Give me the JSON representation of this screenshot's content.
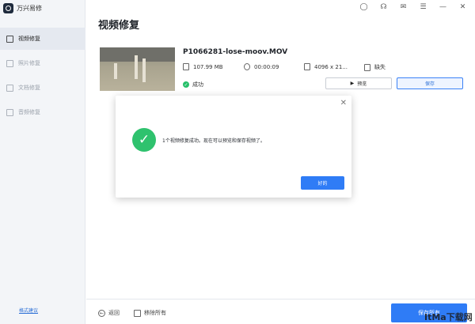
{
  "app": {
    "name": "万兴易修"
  },
  "sidebar": {
    "items": [
      {
        "label": "视频修复",
        "active": true
      },
      {
        "label": "照片修复",
        "active": false
      },
      {
        "label": "文档修复",
        "active": false
      },
      {
        "label": "音频修复",
        "active": false
      }
    ],
    "feedback_label": "格式建议"
  },
  "topbar": {
    "icons": [
      "user-icon",
      "headset-icon",
      "mail-icon",
      "menu-icon",
      "minimize-icon",
      "close-icon"
    ]
  },
  "page": {
    "title": "视频修复"
  },
  "file": {
    "name": "P1066281-lose-moov.MOV",
    "size": "107.99  MB",
    "duration": "00:00:09",
    "resolution": "4096 x 21...",
    "audio": "缺失",
    "status": "成功",
    "preview_label": "预览",
    "save_label": "保存"
  },
  "dialog": {
    "message": "1个视频修复成功。现在可以预览和保存视频了。",
    "ok_label": "好的"
  },
  "bottom": {
    "back_label": "返回",
    "remove_all_label": "移除所有",
    "save_all_label": "保存所有"
  },
  "watermark": "ItMa下载网",
  "colors": {
    "accent": "#2f7cf6",
    "success": "#2fc26e",
    "sidebar_bg": "#f3f5f8"
  }
}
